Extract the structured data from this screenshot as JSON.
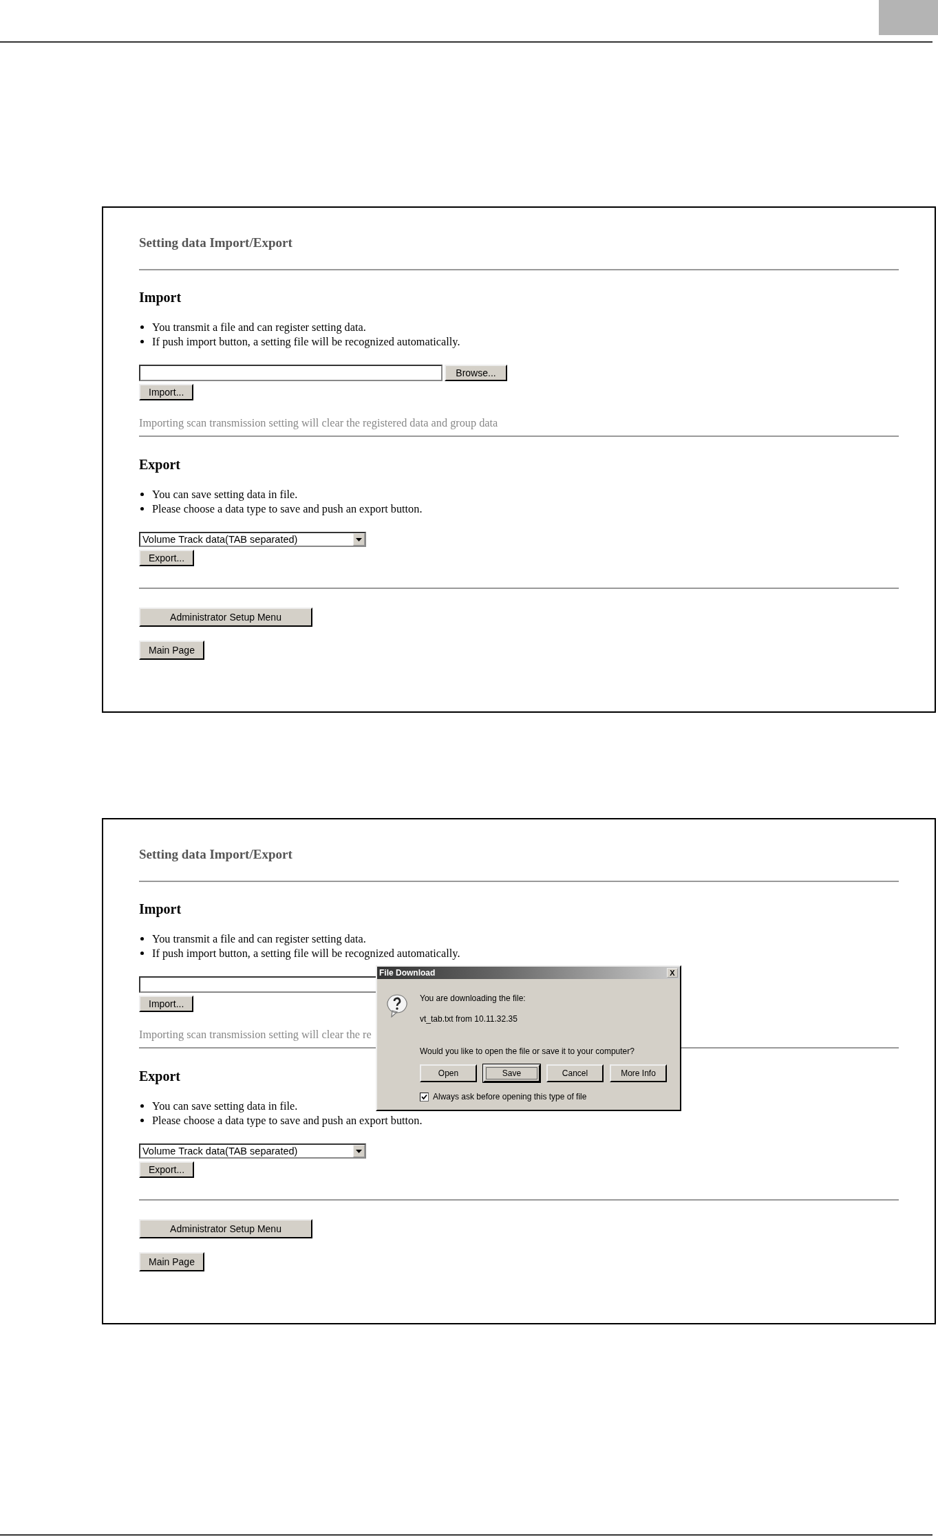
{
  "screens": [
    {
      "title": "Setting data Import/Export",
      "sections": [
        {
          "heading": "Import",
          "bullets": [
            "You transmit a file and can register setting data.",
            "If push import button, a setting file will be recognized automatically."
          ],
          "controls": [
            {
              "kind": "file",
              "browse": "Browse..."
            },
            {
              "kind": "button",
              "label": "Import..."
            }
          ],
          "note": "Importing scan transmission setting will clear the registered data and group data"
        },
        {
          "heading": "Export",
          "bullets": [
            "You can save setting data in file.",
            "Please choose a data type to save and push an export button."
          ],
          "controls": [
            {
              "kind": "select",
              "value": "Volume Track data(TAB separated)"
            },
            {
              "kind": "button",
              "label": "Export..."
            }
          ]
        }
      ],
      "nav_buttons": [
        "Administrator Setup Menu",
        "Main Page"
      ]
    },
    {
      "title": "Setting data Import/Export",
      "sections": [
        {
          "heading": "Import",
          "bullets": [
            "You transmit a file and can register setting data.",
            "If push import button, a setting file will be recognized automatically."
          ],
          "controls": [
            {
              "kind": "file"
            },
            {
              "kind": "button",
              "label": "Import..."
            }
          ],
          "note": "Importing scan transmission setting will clear the re"
        },
        {
          "heading": "Export",
          "bullets": [
            "You can save setting data in file.",
            "Please choose a data type to save and push an export button."
          ],
          "controls": [
            {
              "kind": "select",
              "value": "Volume Track data(TAB separated)"
            },
            {
              "kind": "button",
              "label": "Export..."
            }
          ]
        }
      ],
      "nav_buttons": [
        "Administrator Setup Menu",
        "Main Page"
      ],
      "dialog": {
        "title": "File Download",
        "close": "X",
        "message": "You are downloading the file:",
        "file": "vt_tab.txt from 10.11.32.35",
        "question": "Would you like to open the file or save it to your computer?",
        "buttons": [
          {
            "label": "Open",
            "selected": false
          },
          {
            "label": "Save",
            "selected": true
          },
          {
            "label": "Cancel",
            "selected": false
          },
          {
            "label": "More Info",
            "selected": false
          }
        ],
        "checkbox": {
          "label": "Always ask before opening this type of file",
          "checked": true
        }
      }
    }
  ]
}
